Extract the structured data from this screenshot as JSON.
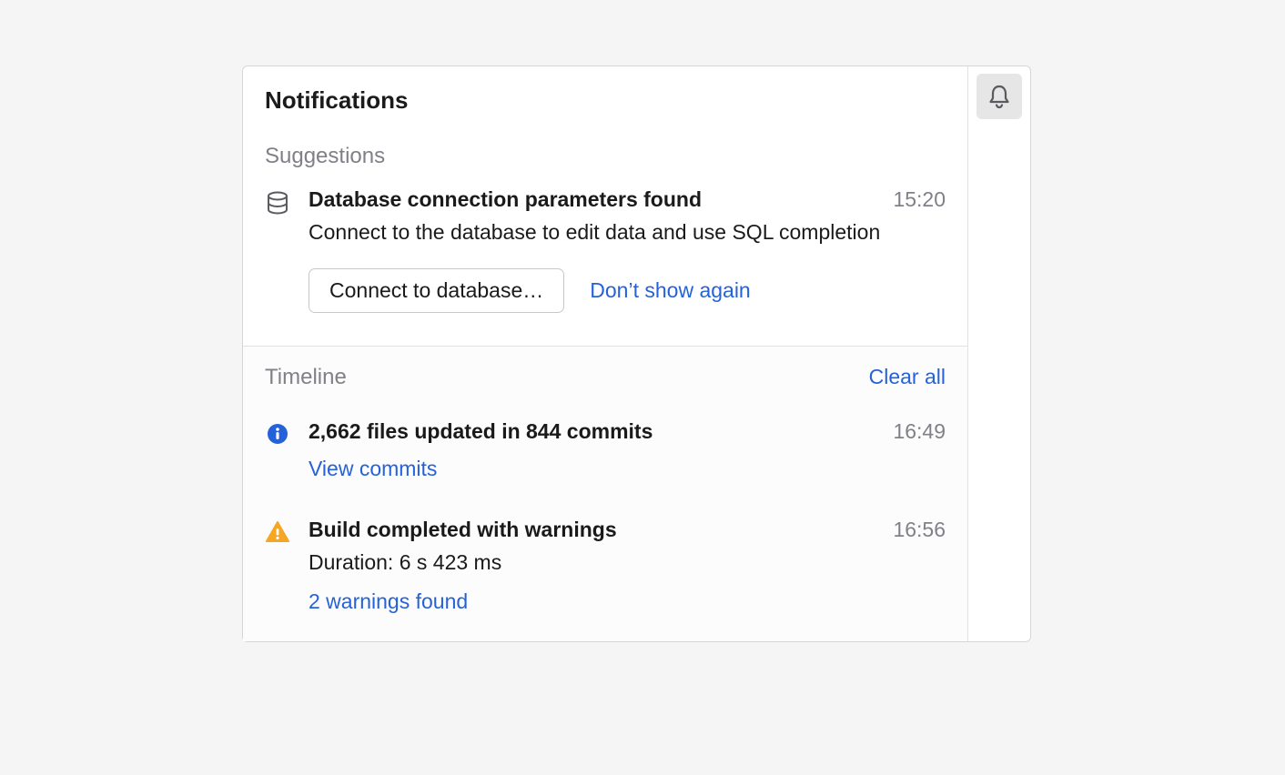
{
  "header": {
    "title": "Notifications"
  },
  "suggestions": {
    "label": "Suggestions",
    "items": [
      {
        "icon": "database-icon",
        "title": "Database connection parameters found",
        "time": "15:20",
        "description": "Connect to the database to edit data and use SQL completion",
        "primary_action": "Connect to database…",
        "secondary_action": "Don’t show again"
      }
    ]
  },
  "timeline": {
    "label": "Timeline",
    "clear_label": "Clear all",
    "items": [
      {
        "icon": "info-icon",
        "title": "2,662 files updated in 844 commits",
        "time": "16:49",
        "description": "",
        "link": "View commits"
      },
      {
        "icon": "warning-icon",
        "title": "Build completed with warnings",
        "time": "16:56",
        "description": "Duration: 6 s 423 ms",
        "link": "2 warnings found"
      }
    ]
  }
}
